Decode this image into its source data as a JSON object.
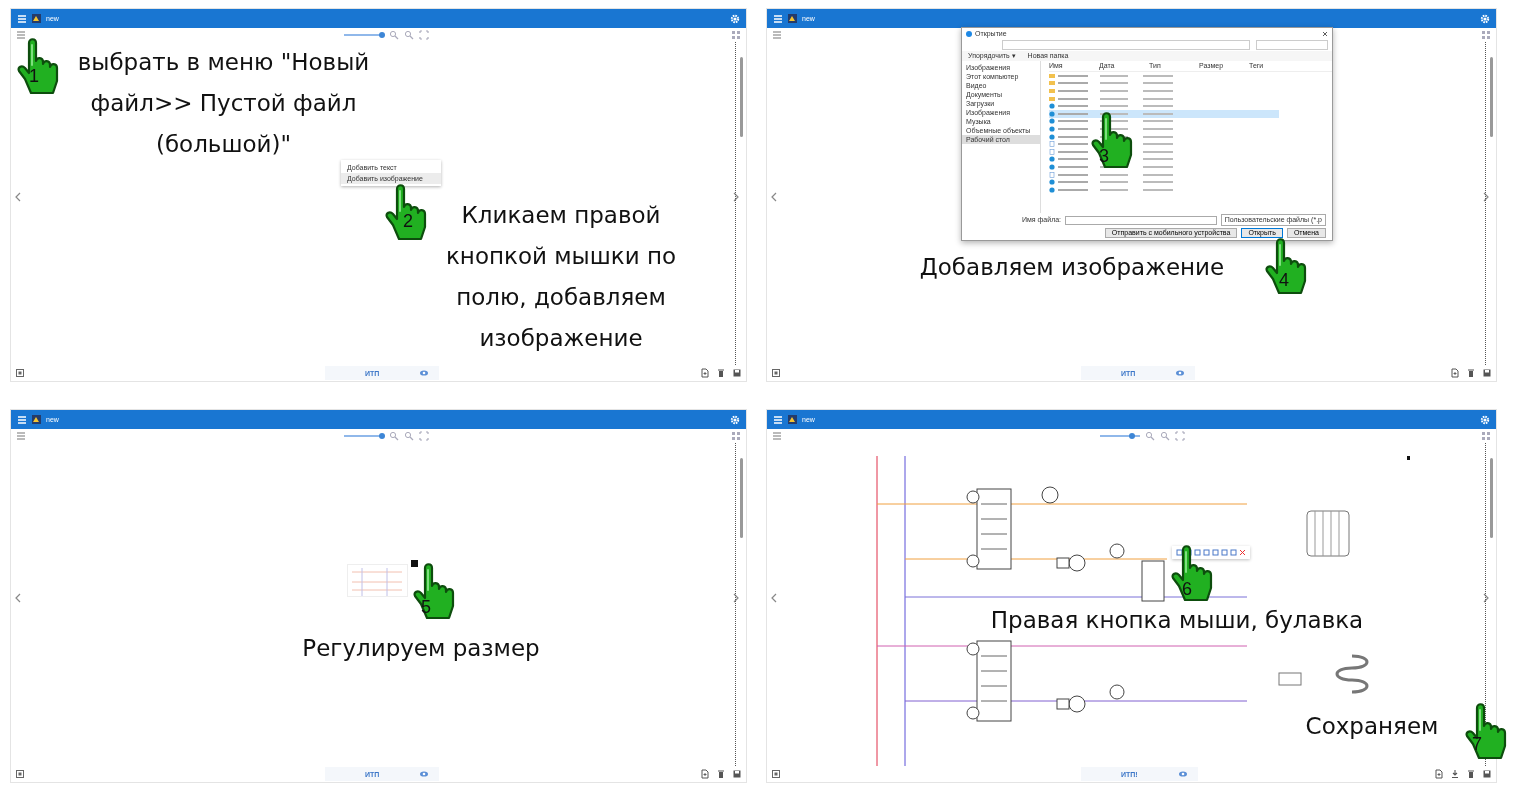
{
  "panels": [
    {
      "kind": "menu",
      "title": "new",
      "tab": "ИТП",
      "actions": [
        {
          "kind": "add-page"
        },
        {
          "kind": "trash"
        },
        {
          "kind": "save"
        }
      ],
      "zoom_slider": {
        "level": 0.95
      },
      "menu_items": [
        {
          "label": "Добавить текст",
          "selected": false
        },
        {
          "label": "Добавить изображение",
          "selected": true
        }
      ],
      "steps": [
        {
          "number": "1",
          "caption": "выбрать в меню \"Новый файл>> Пустой файл (большой)\""
        },
        {
          "number": "2",
          "caption": "Кликаем правой кнопкой мышки по полю, добавляем изображение"
        }
      ]
    },
    {
      "kind": "dialog",
      "title": "new",
      "tab": "ИТП",
      "actions": [
        {
          "kind": "add-page"
        },
        {
          "kind": "trash"
        },
        {
          "kind": "save"
        }
      ],
      "dialog": {
        "title": "Открытие",
        "toolbar": [
          "Упорядочить ▾",
          "Новая папка"
        ],
        "nav_items": [
          {
            "label": "Изображения",
            "selected": false
          },
          {
            "label": "Этот компьютер",
            "selected": false
          },
          {
            "label": "Видео",
            "selected": false
          },
          {
            "label": "Документы",
            "selected": false
          },
          {
            "label": "Загрузки",
            "selected": false
          },
          {
            "label": "Изображения",
            "selected": false
          },
          {
            "label": "Музыка",
            "selected": false
          },
          {
            "label": "Объемные объекты",
            "selected": false
          },
          {
            "label": "Рабочий стол",
            "selected": true
          }
        ],
        "columns": [
          "Имя",
          "Дата",
          "Тип",
          "Размер",
          "Теги"
        ],
        "rows": [
          {
            "kind": "folder",
            "selected": false
          },
          {
            "kind": "folder",
            "selected": false
          },
          {
            "kind": "folder",
            "selected": false
          },
          {
            "kind": "folder",
            "selected": false
          },
          {
            "kind": "web",
            "selected": false
          },
          {
            "kind": "web",
            "selected": true
          },
          {
            "kind": "web",
            "selected": false
          },
          {
            "kind": "web",
            "selected": false
          },
          {
            "kind": "web",
            "selected": false
          },
          {
            "kind": "image",
            "selected": false
          },
          {
            "kind": "image",
            "selected": false
          },
          {
            "kind": "web",
            "selected": false
          },
          {
            "kind": "web",
            "selected": false
          },
          {
            "kind": "image",
            "selected": false
          },
          {
            "kind": "web",
            "selected": false
          },
          {
            "kind": "web",
            "selected": false
          }
        ],
        "filename_label": "Имя файла:",
        "filter": "Пользовательские файлы (*.p",
        "buttons": [
          "Отправить с мобильного устройства",
          "Открыть",
          "Отмена"
        ]
      },
      "steps": [
        {
          "number": "3"
        },
        {
          "number": "4",
          "caption": "Добавляем изображение"
        }
      ]
    },
    {
      "kind": "resize",
      "title": "new",
      "tab": "ИТП",
      "actions": [
        {
          "kind": "add-page"
        },
        {
          "kind": "trash"
        },
        {
          "kind": "save"
        }
      ],
      "zoom_slider": {
        "level": 0.95
      },
      "steps": [
        {
          "number": "5",
          "caption": "Регулируем размер"
        }
      ]
    },
    {
      "kind": "scheme",
      "title": "new",
      "tab": "ИТП!",
      "actions": [
        {
          "kind": "add-page"
        },
        {
          "kind": "download"
        },
        {
          "kind": "trash"
        },
        {
          "kind": "save"
        }
      ],
      "zoom_slider": {
        "level": 0.8
      },
      "steps": [
        {
          "number": "6",
          "caption": "Правая кнопка мыши, булавка"
        },
        {
          "number": "7",
          "caption": "Сохраняем"
        }
      ]
    }
  ]
}
